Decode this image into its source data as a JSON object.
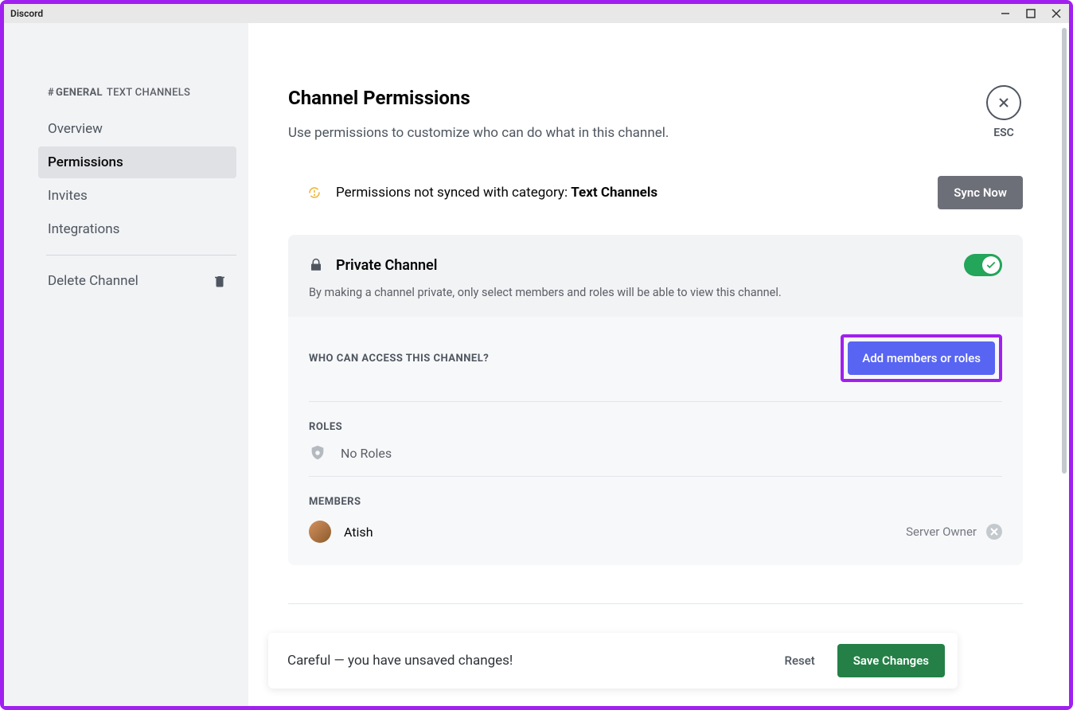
{
  "titlebar": {
    "title": "Discord"
  },
  "sidebar": {
    "channel_prefix": "#",
    "channel_name": "GENERAL",
    "channel_category": "TEXT CHANNELS",
    "nav": {
      "overview": "Overview",
      "permissions": "Permissions",
      "invites": "Invites",
      "integrations": "Integrations",
      "delete": "Delete Channel"
    }
  },
  "close": {
    "esc_label": "ESC"
  },
  "page": {
    "title": "Channel Permissions",
    "subtitle": "Use permissions to customize who can do what in this channel."
  },
  "sync": {
    "text_prefix": "Permissions not synced with category: ",
    "category": "Text Channels",
    "button": "Sync Now"
  },
  "private": {
    "title": "Private Channel",
    "description": "By making a channel private, only select members and roles will be able to view this channel.",
    "toggle_on": true
  },
  "access": {
    "heading": "WHO CAN ACCESS THIS CHANNEL?",
    "add_button": "Add members or roles"
  },
  "roles": {
    "heading": "ROLES",
    "empty": "No Roles"
  },
  "members": {
    "heading": "MEMBERS",
    "list": [
      {
        "name": "Atish",
        "role": "Server Owner"
      }
    ]
  },
  "unsaved": {
    "message": "Careful — you have unsaved changes!",
    "reset": "Reset",
    "save": "Save Changes"
  }
}
